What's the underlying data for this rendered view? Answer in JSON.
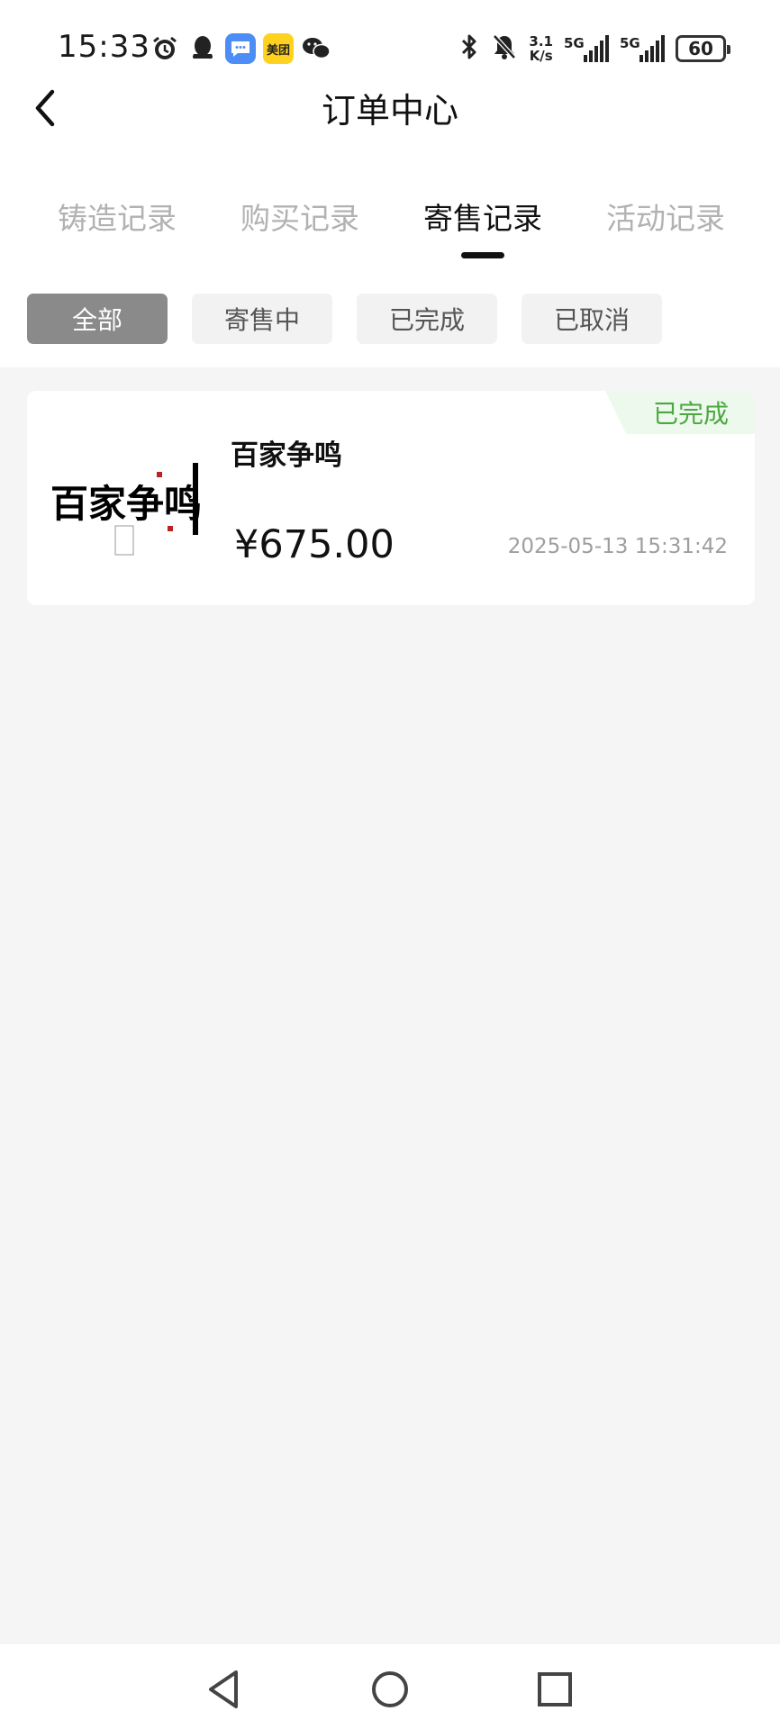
{
  "status_bar": {
    "time": "15:33",
    "left_icons": [
      "alarm-icon",
      "qq-icon",
      "message-icon",
      "meituan-icon",
      "wechat-icon"
    ],
    "meituan_label": "美团",
    "net_speed_value": "3.1",
    "net_speed_unit": "K/s",
    "signal1_label": "5G",
    "signal2_label": "5G",
    "battery": "60"
  },
  "header": {
    "title": "订单中心"
  },
  "tabs": [
    {
      "label": "铸造记录",
      "active": false
    },
    {
      "label": "购买记录",
      "active": false
    },
    {
      "label": "寄售记录",
      "active": true
    },
    {
      "label": "活动记录",
      "active": false
    }
  ],
  "filters": [
    {
      "label": "全部",
      "active": true
    },
    {
      "label": "寄售中",
      "active": false
    },
    {
      "label": "已完成",
      "active": false
    },
    {
      "label": "已取消",
      "active": false
    }
  ],
  "orders": [
    {
      "status": "已完成",
      "name": "百家争鸣",
      "price": "¥675.00",
      "datetime": "2025-05-13 15:31:42",
      "thumbnail_text": "百家争鸣"
    }
  ],
  "colors": {
    "accent_green": "#4aa83f",
    "active_chip": "#8a8a8a",
    "page_bg": "#f5f5f5"
  }
}
